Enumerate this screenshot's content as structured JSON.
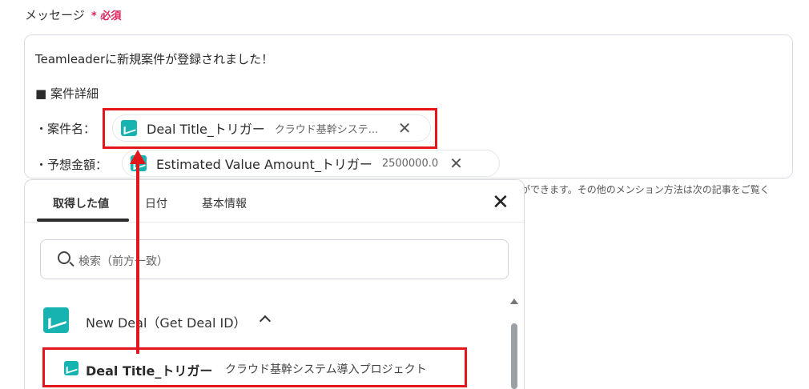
{
  "field": {
    "label": "メッセージ",
    "required": "* 必須"
  },
  "message": {
    "line1": "Teamleaderに新規案件が登録されました！",
    "line2": "■ 案件詳細",
    "line3_label": "・案件名：",
    "line4_label": "・予想金額："
  },
  "chips": [
    {
      "name": "Deal Title_トリガー",
      "value": "クラウド基幹システ..."
    },
    {
      "name": "Estimated Value Amount_トリガー",
      "value": "2500000.0"
    }
  ],
  "hint": "ができます。その他のメンション方法は次の記事をご覧く",
  "dropdown": {
    "tabs": [
      "取得した値",
      "日付",
      "基本情報"
    ],
    "search_placeholder": "検索（前方一致）",
    "group_title": "New Deal（Get Deal ID）",
    "item": {
      "name": "Deal Title_トリガー",
      "value": "クラウド基幹システム導入プロジェクト"
    }
  },
  "colors": {
    "accent_teal": "#17b3b0",
    "highlight_red": "#e3161c",
    "required_pink": "#e0245e"
  }
}
